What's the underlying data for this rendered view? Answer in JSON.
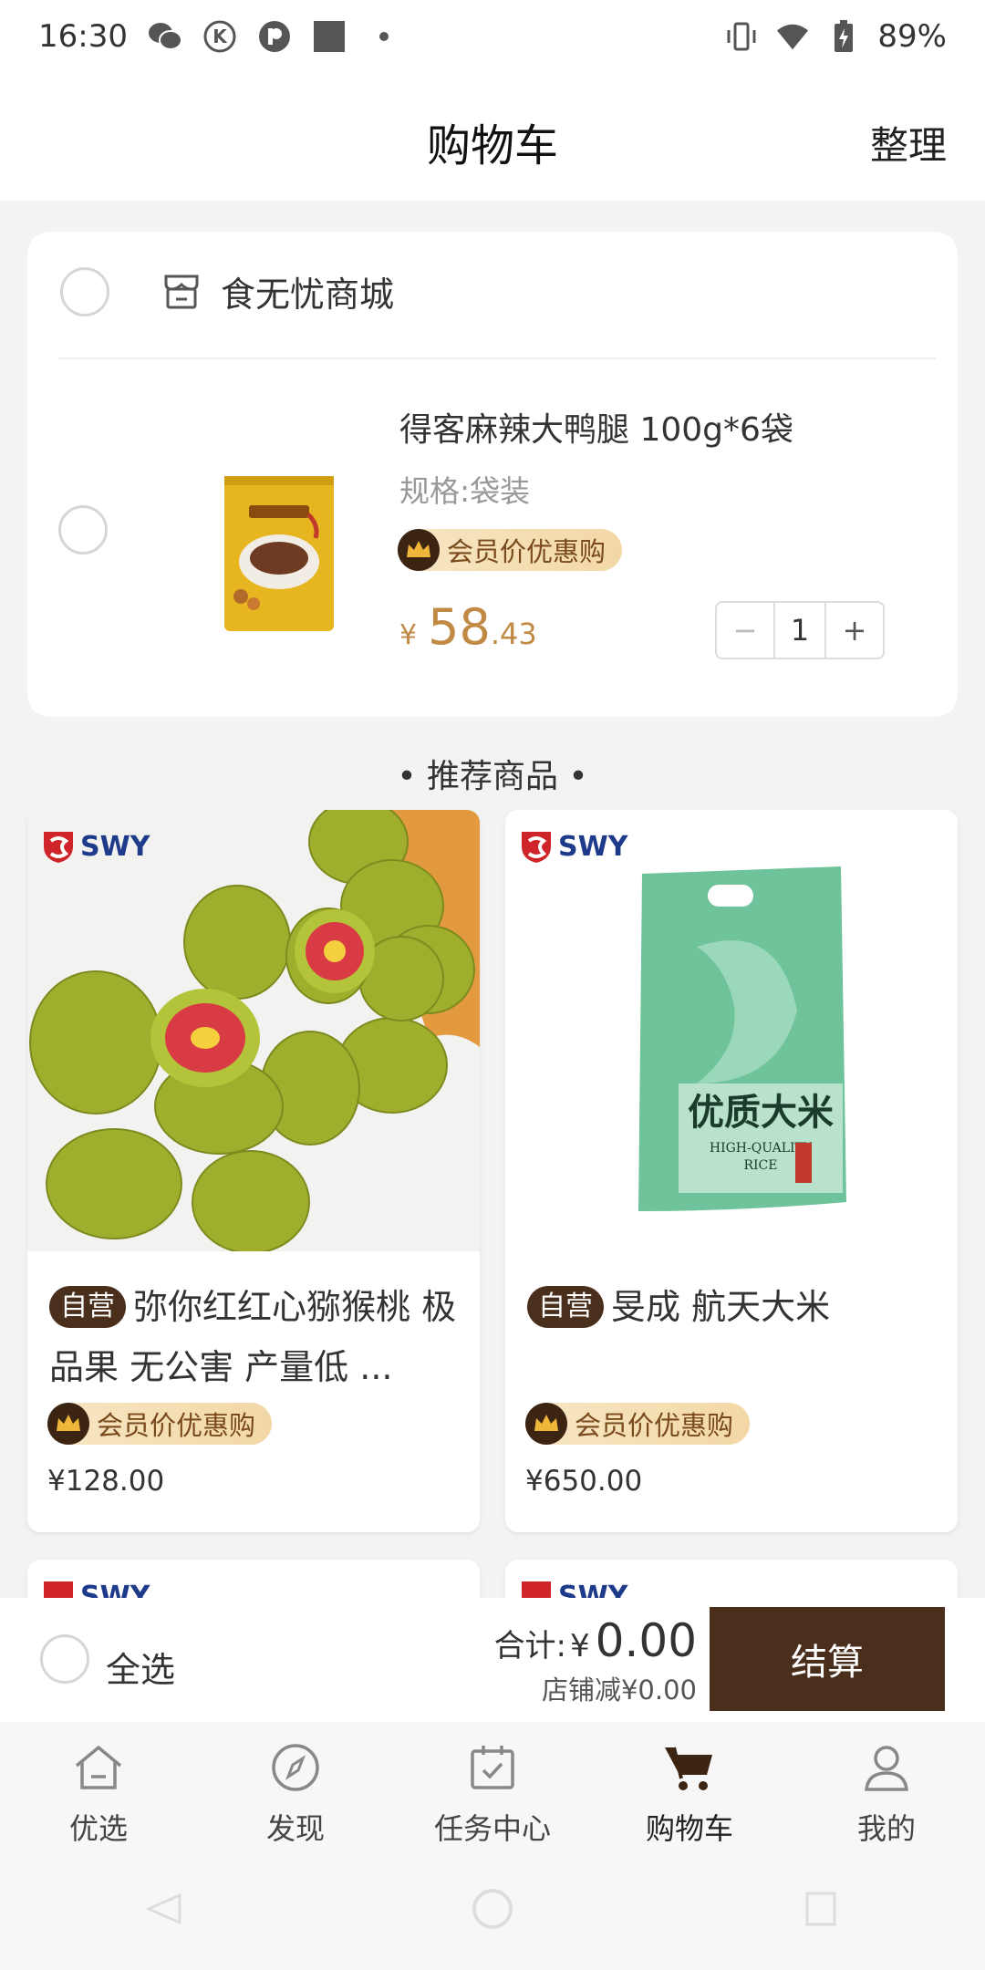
{
  "status_bar": {
    "time": "16:30",
    "battery": "89%"
  },
  "header": {
    "title": "购物车",
    "action": "整理"
  },
  "cart": {
    "shop_name": "食无忧商城",
    "item": {
      "title": "得客麻辣大鸭腿 100g*6袋",
      "spec": "规格:袋装",
      "badge": "会员价优惠购",
      "currency": "¥",
      "price_int": "58",
      "price_dec": ".43",
      "quantity": "1",
      "minus": "−",
      "plus": "+"
    }
  },
  "recommend": {
    "title": "• 推荐商品 •",
    "brand": "SWY",
    "products": [
      {
        "tag": "自营",
        "name": "弥你红红心猕猴桃 极品果 无公害 产量低 ...",
        "badge": "会员价优惠购",
        "price": "¥128.00"
      },
      {
        "tag": "自营",
        "name": "旻成 航天大米",
        "badge": "会员价优惠购",
        "price": "¥650.00"
      }
    ],
    "rice_pack": {
      "cn": "优质大米",
      "en1": "HIGH-QUALITY",
      "en2": "RICE"
    }
  },
  "bottom_bar": {
    "select_all": "全选",
    "total_label": "合计:",
    "currency": "¥",
    "total": "0.00",
    "shop_discount": "店铺减¥0.00",
    "checkout": "结算"
  },
  "tabs": [
    {
      "label": "优选",
      "icon": "home-icon"
    },
    {
      "label": "发现",
      "icon": "compass-icon"
    },
    {
      "label": "任务中心",
      "icon": "calendar-icon"
    },
    {
      "label": "购物车",
      "icon": "cart-icon",
      "active": true
    },
    {
      "label": "我的",
      "icon": "user-icon"
    }
  ],
  "colors": {
    "accent": "#4a2f1d",
    "price": "#c08a45",
    "badge_bg": "#f3d8a6"
  }
}
